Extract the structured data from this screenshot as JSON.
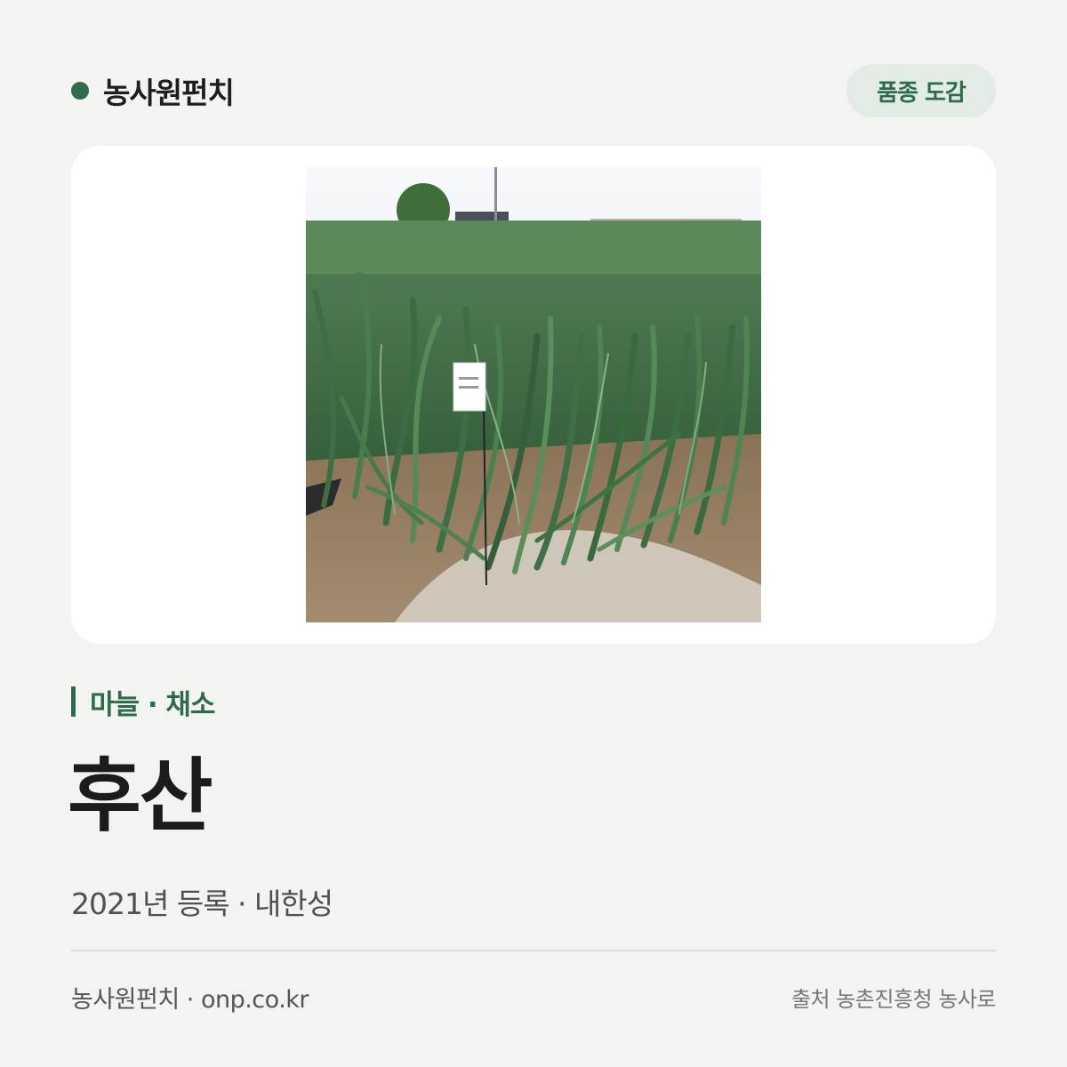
{
  "brand": {
    "name": "농사원펀치",
    "dot_icon": "circle-icon",
    "accent_color": "#2e6b4a"
  },
  "badge": {
    "label": "품종 도감"
  },
  "photo": {
    "subject": "garlic-field-photo"
  },
  "category": {
    "label": "마늘 · 채소"
  },
  "variety": {
    "name": "후산"
  },
  "meta": {
    "text": "2021년 등록 · 내한성"
  },
  "footer": {
    "site": "농사원펀치 · onp.co.kr",
    "source": "출처 농촌진흥청 농사로"
  }
}
